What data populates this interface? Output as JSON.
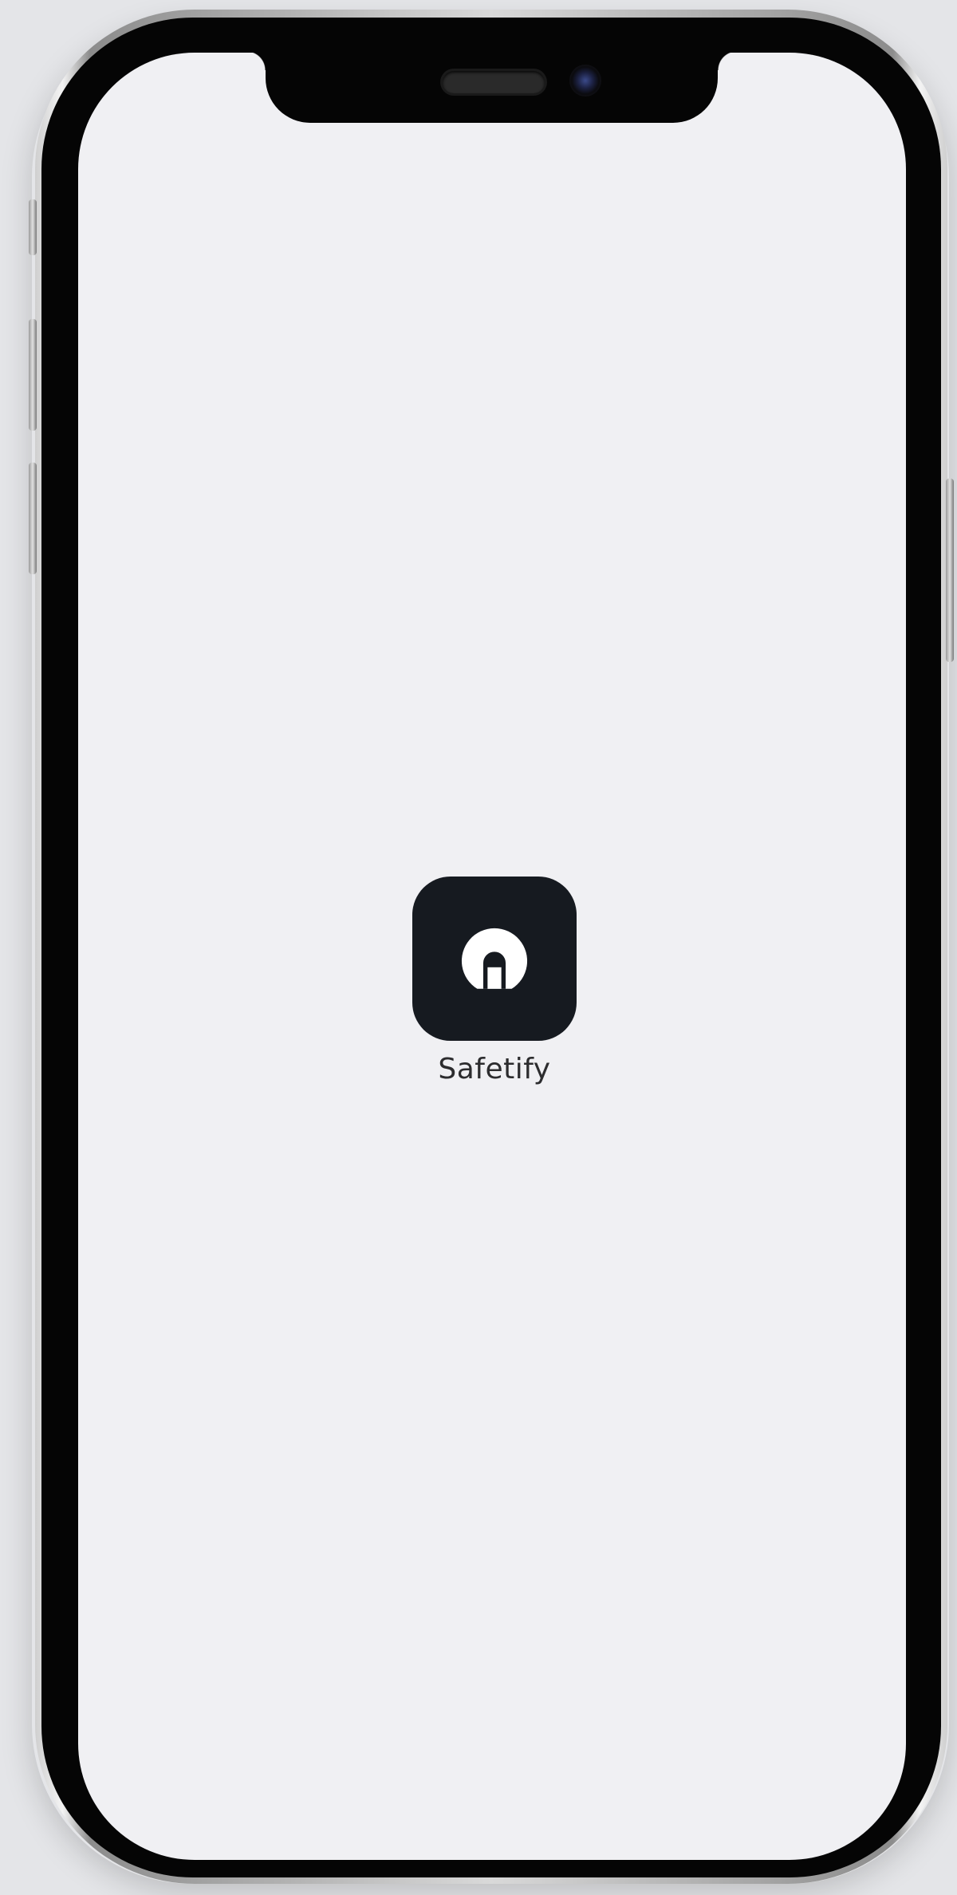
{
  "home_screen": {
    "apps": [
      {
        "label": "Safetify",
        "icon": "lock-icon",
        "icon_background": "#161a20",
        "icon_foreground": "#ffffff"
      }
    ]
  },
  "colors": {
    "screen_background": "#f0f0f3",
    "bezel": "#050505"
  }
}
